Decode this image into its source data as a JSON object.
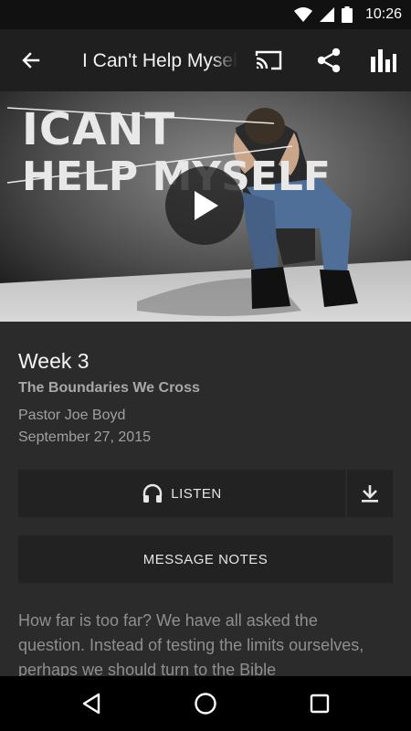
{
  "status_bar": {
    "time": "10:26",
    "icons": [
      "wifi-icon",
      "signal-icon",
      "battery-icon"
    ]
  },
  "app_bar": {
    "title": "I Can't Help Myself",
    "icons": [
      "back-arrow-icon",
      "cast-icon",
      "share-icon",
      "equalizer-icon"
    ]
  },
  "hero": {
    "artwork_text_line1": "ICANT",
    "artwork_text_line2": "HELP MYSELF",
    "play_icon": "play-icon"
  },
  "sermon": {
    "week": "Week 3",
    "subtitle": "The Boundaries We Cross",
    "speaker": "Pastor Joe Boyd",
    "date": "September 27, 2015"
  },
  "actions": {
    "listen_label": "LISTEN",
    "listen_icon": "headphones-icon",
    "download_icon": "download-icon",
    "notes_label": "MESSAGE NOTES"
  },
  "description": "How far is too far? We have all asked the question. Instead of testing the limits ourselves, perhaps we should turn to the Bible",
  "nav_bar": {
    "icons": [
      "back-triangle-icon",
      "home-circle-icon",
      "recents-square-icon"
    ]
  },
  "colors": {
    "background": "#2b2b2b",
    "app_bar": "#1f1f1f",
    "button": "#222222",
    "text_muted": "#a0a0a0"
  }
}
